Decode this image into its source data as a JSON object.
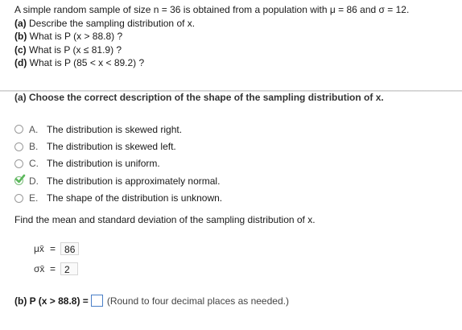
{
  "problem": {
    "intro_prefix": "A simple random sample of size n = 36 is obtained from a population with ",
    "intro_mu": "μ = 86",
    "intro_sigma": "σ = 12.",
    "part_a_label": "(a)",
    "part_a_text": "Describe the sampling distribution of x.",
    "part_b_label": "(b)",
    "part_b_text": "What is P (x > 88.8) ?",
    "part_c_label": "(c)",
    "part_c_text": "What is P (x ≤ 81.9) ?",
    "part_d_label": "(d)",
    "part_d_text": "What is P (85 < x < 89.2) ?"
  },
  "part_a": {
    "title": "(a) Choose the correct description of the shape of the sampling distribution of x.",
    "choices": [
      {
        "letter": "A.",
        "text": "The distribution is skewed right.",
        "selected": false
      },
      {
        "letter": "B.",
        "text": "The distribution is skewed left.",
        "selected": false
      },
      {
        "letter": "C.",
        "text": "The distribution is uniform.",
        "selected": false
      },
      {
        "letter": "D.",
        "text": "The distribution is approximately normal.",
        "selected": true
      },
      {
        "letter": "E.",
        "text": "The shape of the distribution is unknown.",
        "selected": false
      }
    ],
    "find_text": "Find the mean and standard deviation of the sampling distribution of x.",
    "mean_symbol": "μx̄",
    "mean_value": "86",
    "sd_symbol": "σx̄",
    "sd_value": "2"
  },
  "part_b": {
    "prompt": "(b) P (x > 88.8) =",
    "answer": "",
    "note": "(Round to four decimal places as needed.)"
  },
  "colors": {
    "check": "#5cb85c",
    "answer_border": "#4a7fc7",
    "divider": "#c9c9c9"
  }
}
